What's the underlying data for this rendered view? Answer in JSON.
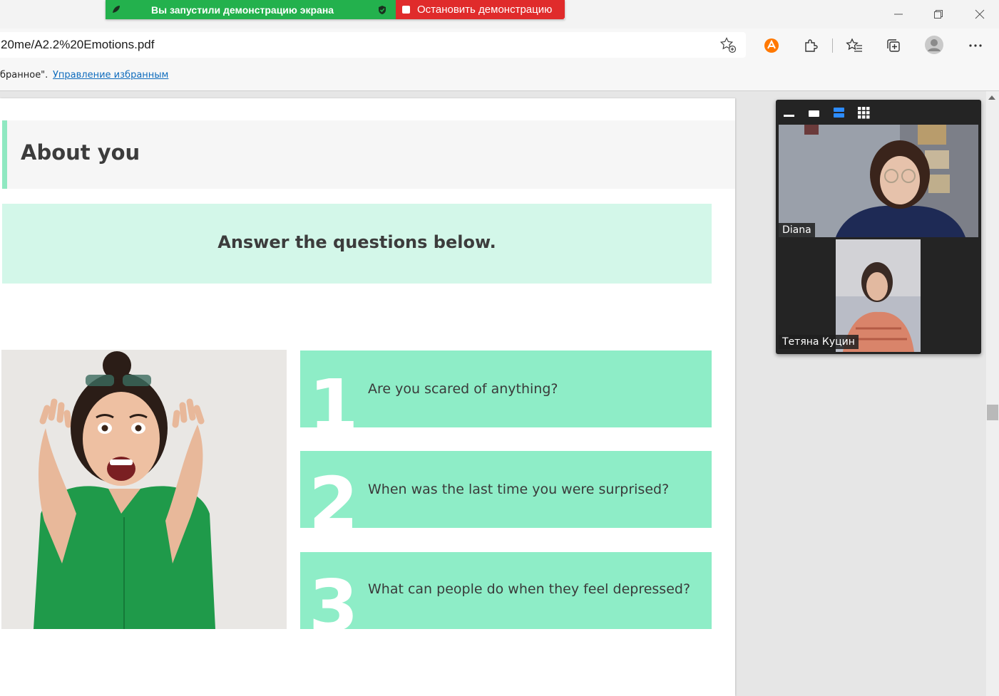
{
  "screen_share": {
    "status_text": "Вы запустили демонстрацию экрана",
    "stop_label": "Остановить демонстрацию"
  },
  "browser": {
    "address": "20me/A2.2%20Emotions.pdf",
    "favorites_text": "бранное\".",
    "favorites_link": "Управление избранным",
    "toolbar_icons": [
      "add-favorite-icon",
      "avast-icon",
      "extensions-icon",
      "favorites-icon",
      "collections-icon",
      "profile-icon",
      "more-icon"
    ]
  },
  "document": {
    "section_title": "About you",
    "instruction": "Answer the questions below.",
    "questions": [
      {
        "number": "1",
        "text": "Are you scared of anything?"
      },
      {
        "number": "2",
        "text": "When was the last time you were surprised?"
      },
      {
        "number": "3",
        "text": "What can people do when they feel depressed?"
      }
    ]
  },
  "video_call": {
    "participants": [
      {
        "name": "Diana"
      },
      {
        "name": "Тетяна Куцин"
      }
    ]
  },
  "colors": {
    "share_green": "#23b14d",
    "share_red": "#e02b2b",
    "mint_light": "#d3f7e9",
    "mint": "#8eedc7",
    "accent_bar": "#8fe8c1",
    "link_blue": "#0f6cbd"
  }
}
